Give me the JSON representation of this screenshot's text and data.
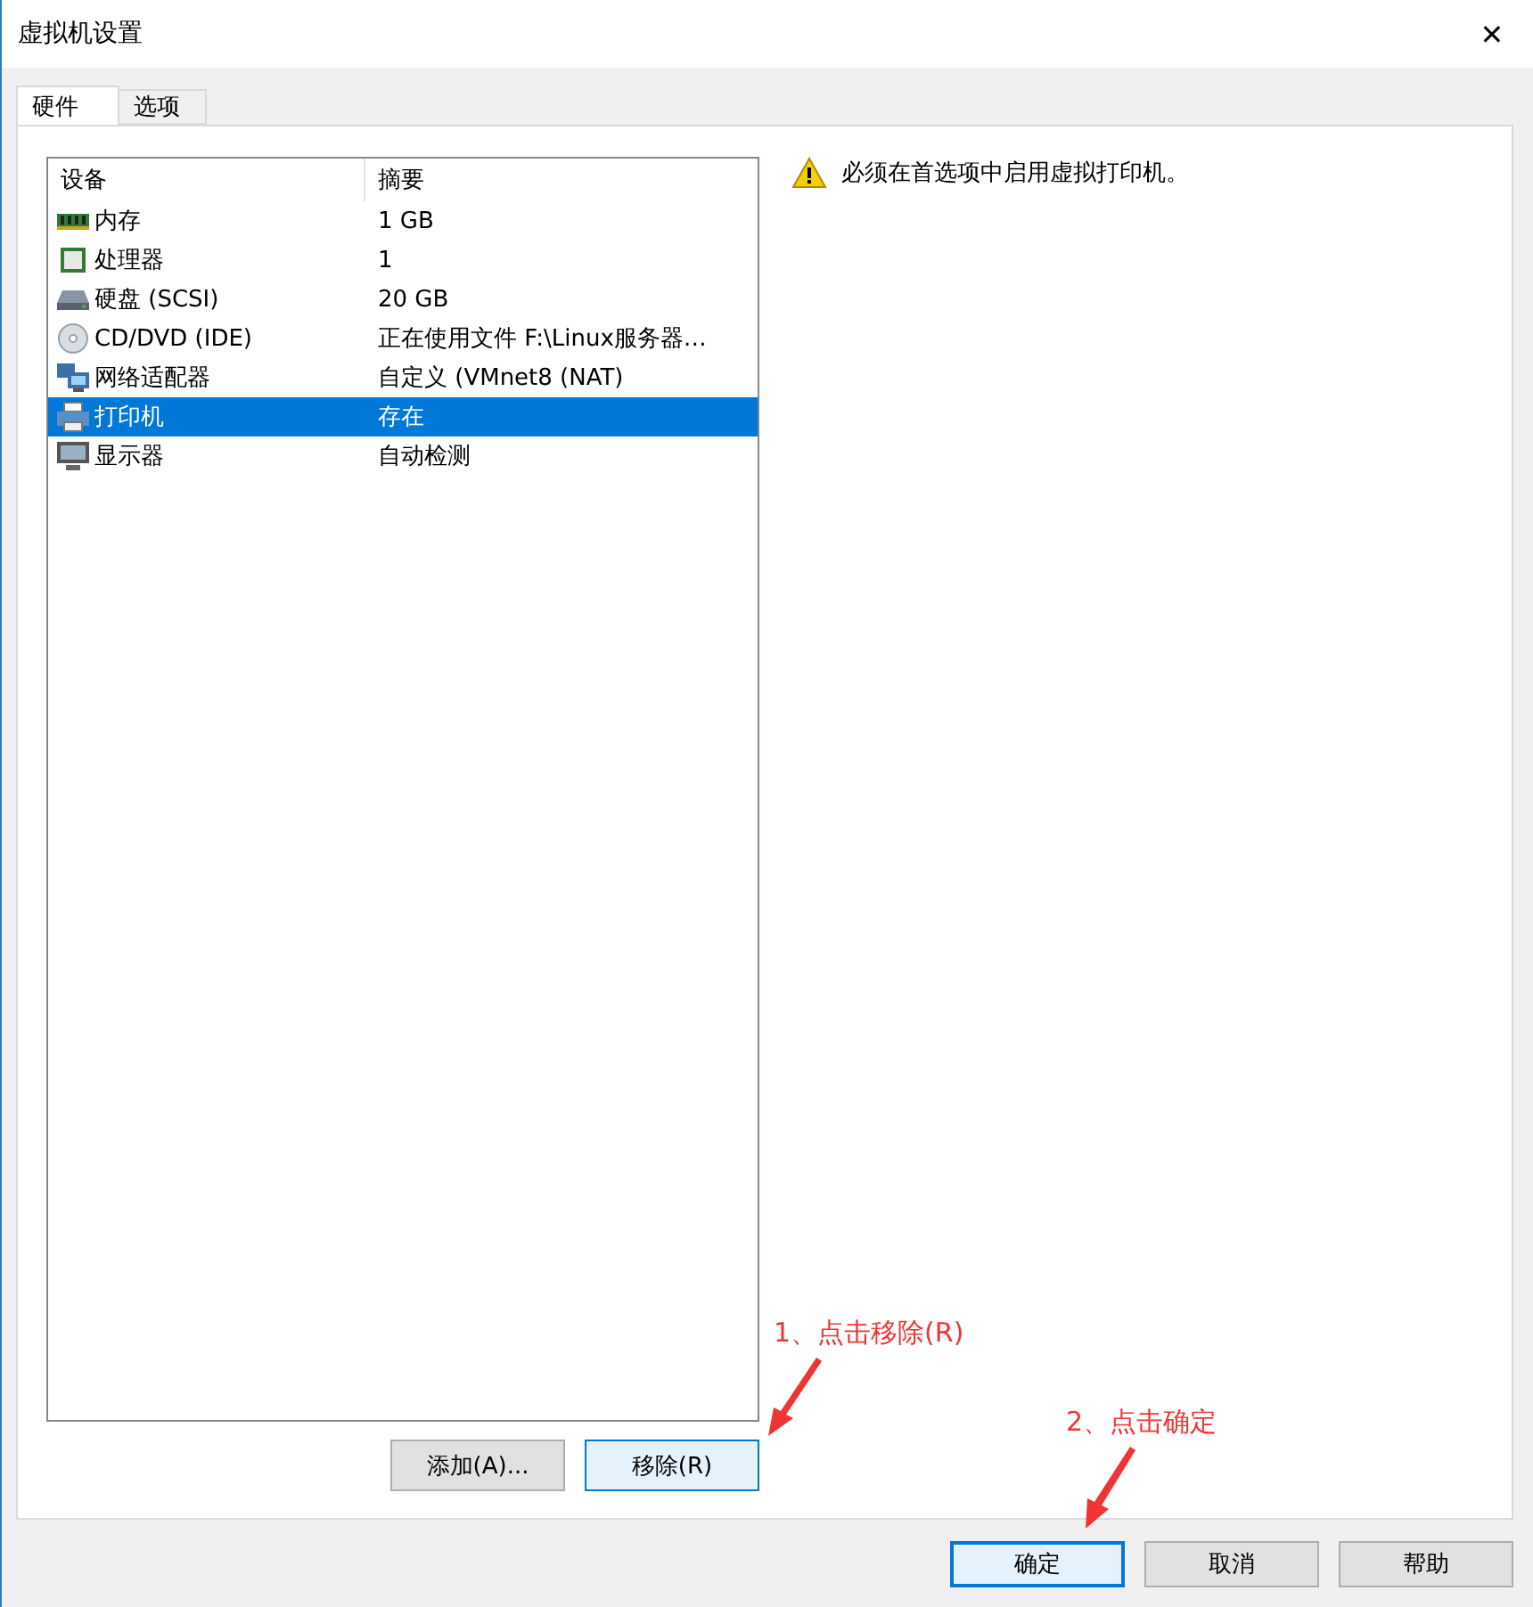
{
  "window": {
    "title": "虚拟机设置",
    "close": "✕"
  },
  "tabs": [
    {
      "label": "硬件",
      "selected": true
    },
    {
      "label": "选项",
      "selected": false
    }
  ],
  "device_list": {
    "columns": [
      "设备",
      "摘要"
    ],
    "rows": [
      {
        "kind": "memory",
        "device": "内存",
        "summary": "1 GB",
        "selected": false
      },
      {
        "kind": "cpu",
        "device": "处理器",
        "summary": "1",
        "selected": false
      },
      {
        "kind": "disk",
        "device": "硬盘 (SCSI)",
        "summary": "20 GB",
        "selected": false
      },
      {
        "kind": "cd",
        "device": "CD/DVD (IDE)",
        "summary": "正在使用文件 F:\\Linux服务器…",
        "selected": false
      },
      {
        "kind": "network",
        "device": "网络适配器",
        "summary": "自定义 (VMnet8 (NAT)",
        "selected": false
      },
      {
        "kind": "printer",
        "device": "打印机",
        "summary": "存在",
        "selected": true
      },
      {
        "kind": "display",
        "device": "显示器",
        "summary": "自动检测",
        "selected": false
      }
    ]
  },
  "list_buttons": [
    {
      "label": "添加(A)...",
      "focused": false
    },
    {
      "label": "移除(R)",
      "focused": true
    }
  ],
  "warning": "必须在首选项中启用虚拟打印机。",
  "dialog_buttons": [
    {
      "label": "确定",
      "focused": true
    },
    {
      "label": "取消",
      "focused": false
    },
    {
      "label": "帮助",
      "focused": false
    }
  ],
  "annotations": [
    {
      "text": "1、点击移除(R)"
    },
    {
      "text": "2、点击确定"
    }
  ]
}
